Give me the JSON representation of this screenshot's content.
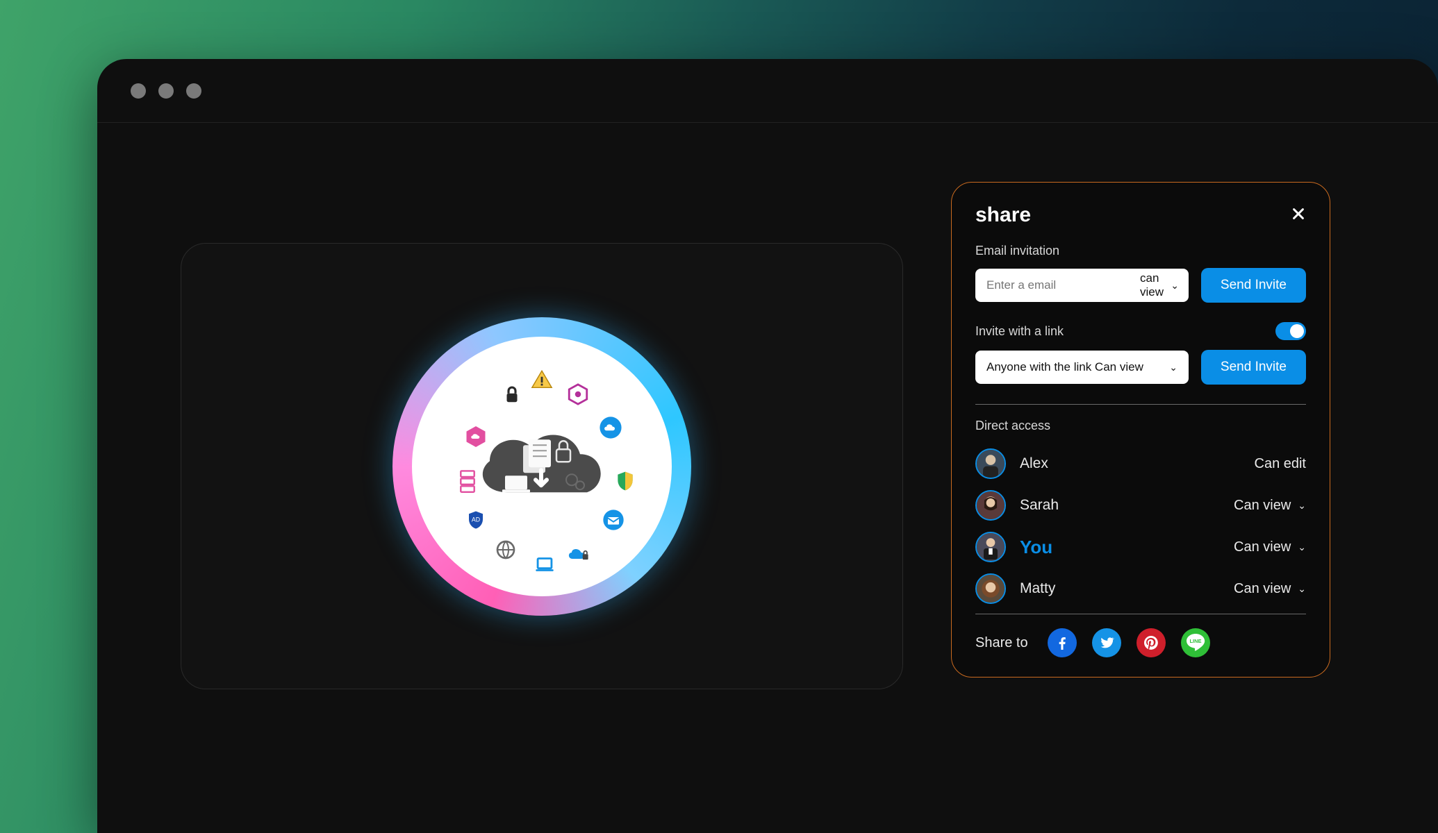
{
  "share": {
    "title": "share",
    "email_section_label": "Email invitation",
    "email_placeholder": "Enter a email",
    "email_perm_label": "can view",
    "send_invite_label": "Send Invite",
    "invite_link_label": "Invite with a link",
    "link_toggle_on": true,
    "link_scope_label": "Anyone with the link Can view",
    "direct_access_label": "Direct access",
    "users": [
      {
        "name": "Alex",
        "permission": "Can edit",
        "has_chevron": false,
        "is_you": false
      },
      {
        "name": "Sarah",
        "permission": "Can view",
        "has_chevron": true,
        "is_you": false
      },
      {
        "name": "You",
        "permission": "Can view",
        "has_chevron": true,
        "is_you": true
      },
      {
        "name": "Matty",
        "permission": "Can view",
        "has_chevron": true,
        "is_you": false
      }
    ],
    "share_to_label": "Share to",
    "socials": [
      {
        "id": "facebook",
        "label": "f"
      },
      {
        "id": "twitter",
        "label": ""
      },
      {
        "id": "pinterest",
        "label": ""
      },
      {
        "id": "line",
        "label": "LINE"
      }
    ]
  }
}
